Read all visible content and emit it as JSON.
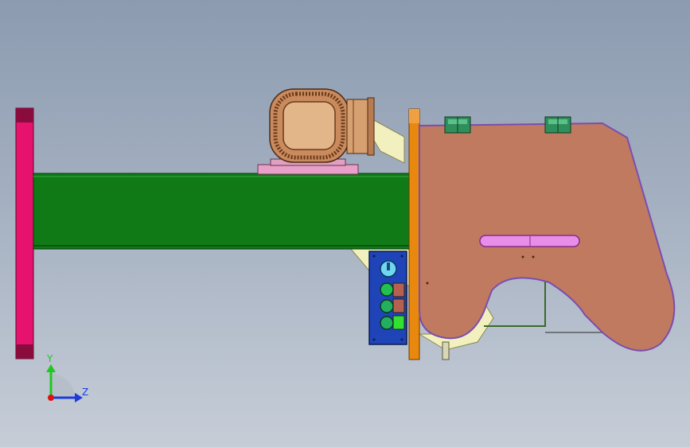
{
  "view": {
    "title": "",
    "background_top": "#8c9bb0",
    "background_bottom": "#c6cdd7"
  },
  "triad": {
    "y_label": "Y",
    "z_label": "Z",
    "y_color": "#1ec81e",
    "z_color": "#1e3cdc",
    "origin_color": "#e01010"
  },
  "parts": {
    "end_plate_color": "#e6126e",
    "beam_color": "#0f7a16",
    "motor_color": "#c98a5e",
    "flange_plate_color": "#e8880e",
    "guard_color": "#c07a5f",
    "guard_outline_color": "#7b4db0",
    "bracket_color": "#f3f0bf",
    "control_box_color": "#1f44b8",
    "slot_color": "#e98ee8",
    "hinge_color": "#2f8f5a"
  }
}
